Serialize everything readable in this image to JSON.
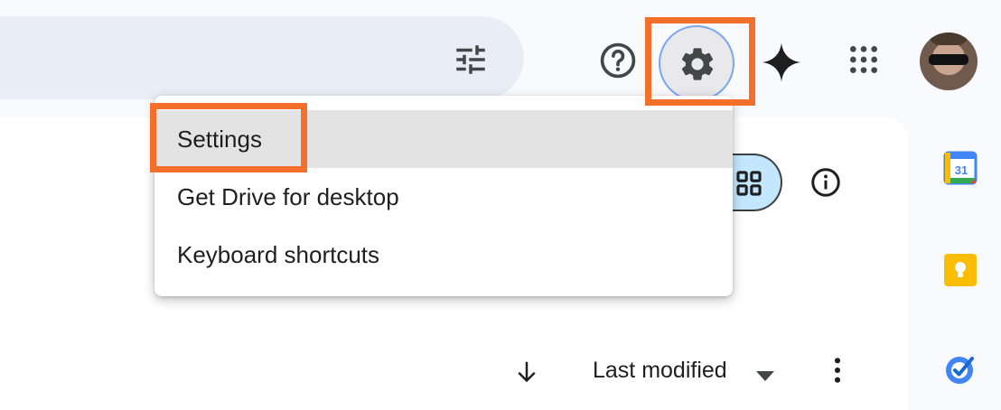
{
  "header": {
    "icons": {
      "tune": "tune-icon",
      "help": "help-icon",
      "settings": "gear-icon",
      "gemini": "sparkle-icon",
      "apps": "apps-grid-icon",
      "account": "avatar"
    }
  },
  "settings_menu": {
    "items": [
      {
        "label": "Settings",
        "highlighted": true
      },
      {
        "label": "Get Drive for desktop",
        "highlighted": false
      },
      {
        "label": "Keyboard shortcuts",
        "highlighted": false
      }
    ]
  },
  "toolbar": {
    "sort_label": "Last modified",
    "view_toggle_icon": "grid-view-icon",
    "info_icon": "info-icon"
  },
  "side_apps": [
    "calendar-icon",
    "keep-icon",
    "tasks-icon"
  ],
  "calendar_day": "31",
  "colors": {
    "annotation": "#f46f2a",
    "search_bg": "#e9eef6",
    "toggle_bg": "#c2e7ff",
    "menu_highlight": "#e3e3e3"
  }
}
